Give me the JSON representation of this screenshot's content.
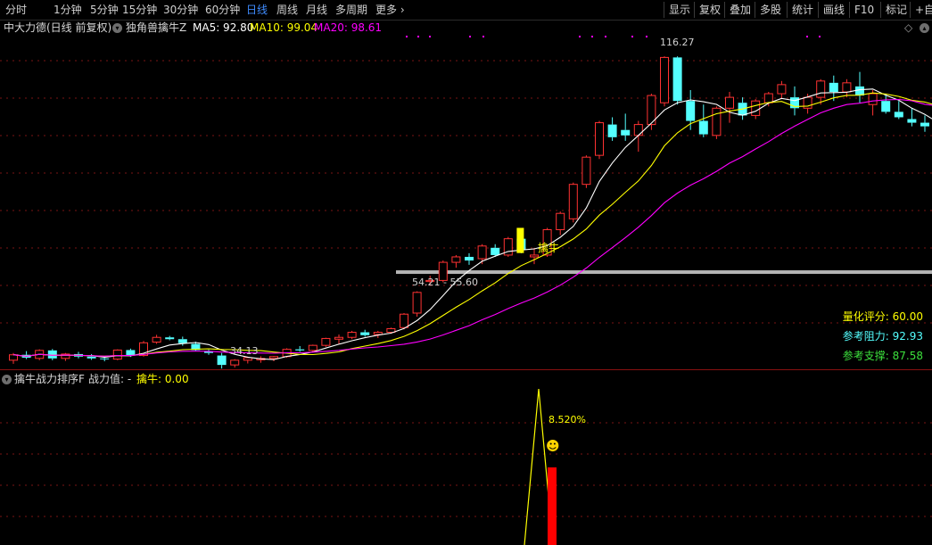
{
  "toolbar": {
    "periods": [
      "分时",
      "1分钟",
      "5分钟",
      "15分钟",
      "30分钟",
      "60分钟",
      "日线",
      "周线",
      "月线",
      "多周期",
      "更多"
    ],
    "active_period": "日线",
    "right_buttons": [
      "显示",
      "复权",
      "叠加",
      "多股",
      "统计",
      "画线",
      "F10",
      "标记",
      "+自"
    ]
  },
  "indicator_header": {
    "stock_title": "中大力德(日线 前复权)",
    "indicator_name": "独角兽擒牛Z",
    "ma5": "MA5: 92.80",
    "ma10": "MA10: 99.04",
    "ma20": "MA20: 98.61"
  },
  "annotations": {
    "high_label": "116.27",
    "low_label": "34.13",
    "range_label": "54.21 - 55.60",
    "signal_label": "擒牛"
  },
  "right_panel": {
    "score_label": "量化评分: ",
    "score_value": "60.00",
    "resistance_label": "参考阻力: ",
    "resistance_value": "92.93",
    "support_label": "参考支撑: ",
    "support_value": "87.58"
  },
  "sub_header": {
    "title": "擒牛战力排序F",
    "zhanli": "战力值: -",
    "qinniu": "擒牛: 0.00"
  },
  "sub_annotations": {
    "percent_label": "8.520%",
    "smiley": "☻"
  },
  "colors": {
    "up": "#ff3232",
    "down": "#54ffff",
    "ma5": "#ffffff",
    "ma10": "#ffff00",
    "ma20": "#ff00ff",
    "signal": "#ffff00",
    "sub_bar": "#ff0000"
  },
  "chart_data": {
    "type": "candlestick",
    "ylim": [
      30,
      122
    ],
    "candles": [
      [
        32.5,
        34.5,
        31.5,
        34.0
      ],
      [
        34.0,
        35.0,
        32.8,
        33.2
      ],
      [
        33.0,
        35.5,
        32.5,
        35.2
      ],
      [
        35.2,
        35.6,
        32.5,
        33.0
      ],
      [
        33.0,
        34.5,
        32.3,
        34.2
      ],
      [
        34.2,
        34.8,
        33.0,
        33.5
      ],
      [
        33.5,
        34.2,
        32.6,
        33.0
      ],
      [
        33.0,
        33.6,
        32.2,
        32.8
      ],
      [
        32.8,
        35.5,
        32.5,
        35.3
      ],
      [
        35.3,
        35.7,
        33.4,
        33.8
      ],
      [
        33.8,
        37.8,
        33.5,
        37.3
      ],
      [
        37.5,
        39.5,
        37.0,
        38.8
      ],
      [
        38.8,
        39.2,
        38.0,
        38.3
      ],
      [
        38.3,
        39.0,
        36.5,
        37.2
      ],
      [
        37.0,
        37.6,
        35.0,
        35.3
      ],
      [
        35.0,
        35.4,
        34.0,
        34.5
      ],
      [
        33.8,
        34.5,
        30.2,
        31.2
      ],
      [
        31.2,
        32.8,
        30.5,
        32.5
      ],
      [
        32.5,
        33.5,
        31.6,
        33.2
      ],
      [
        32.6,
        33.6,
        31.8,
        33.0
      ],
      [
        33.0,
        33.7,
        32.2,
        33.5
      ],
      [
        33.5,
        35.8,
        33.2,
        35.5
      ],
      [
        35.5,
        36.4,
        34.8,
        35.2
      ],
      [
        35.2,
        36.8,
        34.8,
        36.6
      ],
      [
        36.6,
        38.7,
        36.2,
        38.5
      ],
      [
        38.3,
        39.6,
        37.0,
        38.8
      ],
      [
        38.8,
        40.6,
        38.3,
        40.2
      ],
      [
        40.2,
        40.9,
        39.0,
        39.4
      ],
      [
        39.6,
        40.6,
        38.6,
        40.2
      ],
      [
        40.2,
        41.5,
        39.8,
        41.2
      ],
      [
        41.5,
        45.5,
        41.0,
        45.2
      ],
      [
        45.5,
        51.5,
        44.5,
        51.2
      ],
      [
        54.2,
        55.8,
        53.0,
        54.5
      ],
      [
        54.5,
        60.0,
        54.0,
        59.5
      ],
      [
        59.5,
        61.5,
        58.0,
        61.0
      ],
      [
        61.0,
        62.0,
        58.8,
        60.0
      ],
      [
        60.5,
        64.5,
        59.0,
        64.0
      ],
      [
        63.5,
        64.5,
        61.0,
        61.5
      ],
      [
        61.5,
        66.5,
        61.0,
        66.0
      ],
      [
        66.0,
        67.0,
        62.0,
        63.0
      ],
      [
        61.0,
        63.5,
        59.0,
        61.5
      ],
      [
        61.5,
        69.0,
        61.0,
        68.5
      ],
      [
        68.5,
        73.5,
        67.0,
        73.0
      ],
      [
        71.5,
        81.5,
        70.5,
        81.0
      ],
      [
        81.0,
        89.0,
        80.0,
        88.5
      ],
      [
        89.0,
        98.5,
        88.0,
        98.0
      ],
      [
        97.5,
        99.5,
        93.0,
        94.0
      ],
      [
        96.0,
        100.5,
        93.0,
        94.5
      ],
      [
        94.5,
        98.5,
        90.0,
        97.5
      ],
      [
        97.5,
        106.0,
        96.0,
        105.5
      ],
      [
        103.5,
        116.3,
        102.5,
        116.0
      ],
      [
        116.0,
        116.3,
        103.0,
        104.0
      ],
      [
        104.0,
        107.0,
        96.0,
        98.5
      ],
      [
        98.5,
        103.0,
        94.0,
        94.8
      ],
      [
        94.5,
        102.5,
        93.5,
        102.0
      ],
      [
        102.0,
        106.5,
        98.0,
        105.0
      ],
      [
        103.5,
        105.0,
        98.8,
        100.0
      ],
      [
        100.0,
        104.5,
        99.0,
        104.0
      ],
      [
        103.5,
        106.5,
        102.5,
        106.0
      ],
      [
        106.0,
        109.5,
        104.5,
        108.5
      ],
      [
        105.0,
        108.0,
        100.0,
        102.0
      ],
      [
        102.0,
        106.0,
        100.5,
        105.0
      ],
      [
        105.0,
        110.0,
        103.0,
        109.5
      ],
      [
        109.0,
        111.0,
        104.0,
        106.5
      ],
      [
        106.5,
        110.0,
        105.0,
        109.0
      ],
      [
        108.0,
        112.0,
        103.5,
        105.5
      ],
      [
        103.0,
        107.0,
        100.0,
        106.0
      ],
      [
        104.0,
        106.0,
        100.5,
        101.0
      ],
      [
        101.0,
        104.0,
        99.0,
        99.5
      ],
      [
        99.0,
        102.0,
        97.0,
        98.0
      ],
      [
        98.0,
        100.0,
        95.5,
        97.0
      ],
      [
        97.0,
        99.0,
        94.5,
        95.0
      ]
    ],
    "signal_index": 39,
    "range_line": {
      "price": 56.8,
      "start_index": 30
    }
  },
  "sub_chart_data": {
    "type": "line+bar",
    "peak_label": "8.520%"
  }
}
